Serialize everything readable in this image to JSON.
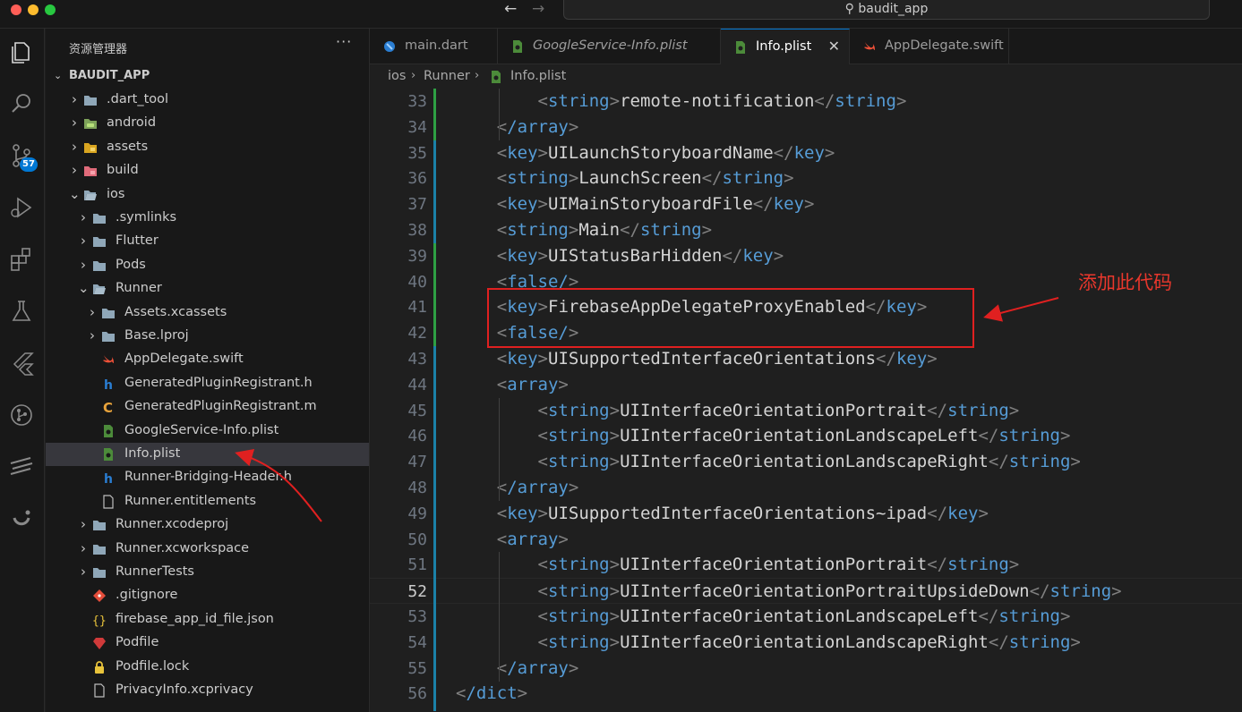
{
  "window": {
    "search_text": "baudit_app"
  },
  "activity": {
    "scm_badge": "57"
  },
  "sidebar": {
    "header": "资源管理器",
    "more": "···",
    "section_title": "BAUDIT_APP",
    "items": [
      {
        "label": ".dart_tool"
      },
      {
        "label": "android"
      },
      {
        "label": "assets"
      },
      {
        "label": "build"
      },
      {
        "label": "ios"
      },
      {
        "label": ".symlinks"
      },
      {
        "label": "Flutter"
      },
      {
        "label": "Pods"
      },
      {
        "label": "Runner"
      },
      {
        "label": "Assets.xcassets"
      },
      {
        "label": "Base.lproj"
      },
      {
        "label": "AppDelegate.swift"
      },
      {
        "label": "GeneratedPluginRegistrant.h"
      },
      {
        "label": "GeneratedPluginRegistrant.m"
      },
      {
        "label": "GoogleService-Info.plist"
      },
      {
        "label": "Info.plist"
      },
      {
        "label": "Runner-Bridging-Header.h"
      },
      {
        "label": "Runner.entitlements"
      },
      {
        "label": "Runner.xcodeproj"
      },
      {
        "label": "Runner.xcworkspace"
      },
      {
        "label": "RunnerTests"
      },
      {
        "label": ".gitignore"
      },
      {
        "label": "firebase_app_id_file.json"
      },
      {
        "label": "Podfile"
      },
      {
        "label": "Podfile.lock"
      },
      {
        "label": "PrivacyInfo.xcprivacy"
      }
    ]
  },
  "tabs": [
    {
      "label": "main.dart"
    },
    {
      "label": "GoogleService-Info.plist"
    },
    {
      "label": "Info.plist"
    },
    {
      "label": "AppDelegate.swift"
    }
  ],
  "breadcrumb": [
    "ios",
    "Runner",
    "Info.plist"
  ],
  "editor": {
    "lines": [
      {
        "num": "33",
        "indent": "        ",
        "tag": "string",
        "text": "remote-notification"
      },
      {
        "num": "34",
        "indent": "    ",
        "tag": "/array",
        "text": ""
      },
      {
        "num": "35",
        "indent": "    ",
        "tag": "key",
        "text": "UILaunchStoryboardName"
      },
      {
        "num": "36",
        "indent": "    ",
        "tag": "string",
        "text": "LaunchScreen"
      },
      {
        "num": "37",
        "indent": "    ",
        "tag": "key",
        "text": "UIMainStoryboardFile"
      },
      {
        "num": "38",
        "indent": "    ",
        "tag": "string",
        "text": "Main"
      },
      {
        "num": "39",
        "indent": "    ",
        "tag": "key",
        "text": "UIStatusBarHidden"
      },
      {
        "num": "40",
        "indent": "    ",
        "tag": "false/",
        "text": ""
      },
      {
        "num": "41",
        "indent": "    ",
        "tag": "key",
        "text": "FirebaseAppDelegateProxyEnabled"
      },
      {
        "num": "42",
        "indent": "    ",
        "tag": "false/",
        "text": ""
      },
      {
        "num": "43",
        "indent": "    ",
        "tag": "key",
        "text": "UISupportedInterfaceOrientations"
      },
      {
        "num": "44",
        "indent": "    ",
        "tag": "array",
        "text": ""
      },
      {
        "num": "45",
        "indent": "        ",
        "tag": "string",
        "text": "UIInterfaceOrientationPortrait"
      },
      {
        "num": "46",
        "indent": "        ",
        "tag": "string",
        "text": "UIInterfaceOrientationLandscapeLeft"
      },
      {
        "num": "47",
        "indent": "        ",
        "tag": "string",
        "text": "UIInterfaceOrientationLandscapeRight"
      },
      {
        "num": "48",
        "indent": "    ",
        "tag": "/array",
        "text": ""
      },
      {
        "num": "49",
        "indent": "    ",
        "tag": "key",
        "text": "UISupportedInterfaceOrientations~ipad"
      },
      {
        "num": "50",
        "indent": "    ",
        "tag": "array",
        "text": ""
      },
      {
        "num": "51",
        "indent": "        ",
        "tag": "string",
        "text": "UIInterfaceOrientationPortrait"
      },
      {
        "num": "52",
        "indent": "        ",
        "tag": "string",
        "text": "UIInterfaceOrientationPortraitUpsideDown"
      },
      {
        "num": "53",
        "indent": "        ",
        "tag": "string",
        "text": "UIInterfaceOrientationLandscapeLeft"
      },
      {
        "num": "54",
        "indent": "        ",
        "tag": "string",
        "text": "UIInterfaceOrientationLandscapeRight"
      },
      {
        "num": "55",
        "indent": "    ",
        "tag": "/array",
        "text": ""
      },
      {
        "num": "56",
        "indent": "",
        "tag": "/dict",
        "text": ""
      }
    ]
  },
  "annotation": {
    "text": "添加此代码"
  },
  "colors": {
    "accent": "#0078d4",
    "annotation": "#e02020",
    "tag": "#569cd6"
  }
}
